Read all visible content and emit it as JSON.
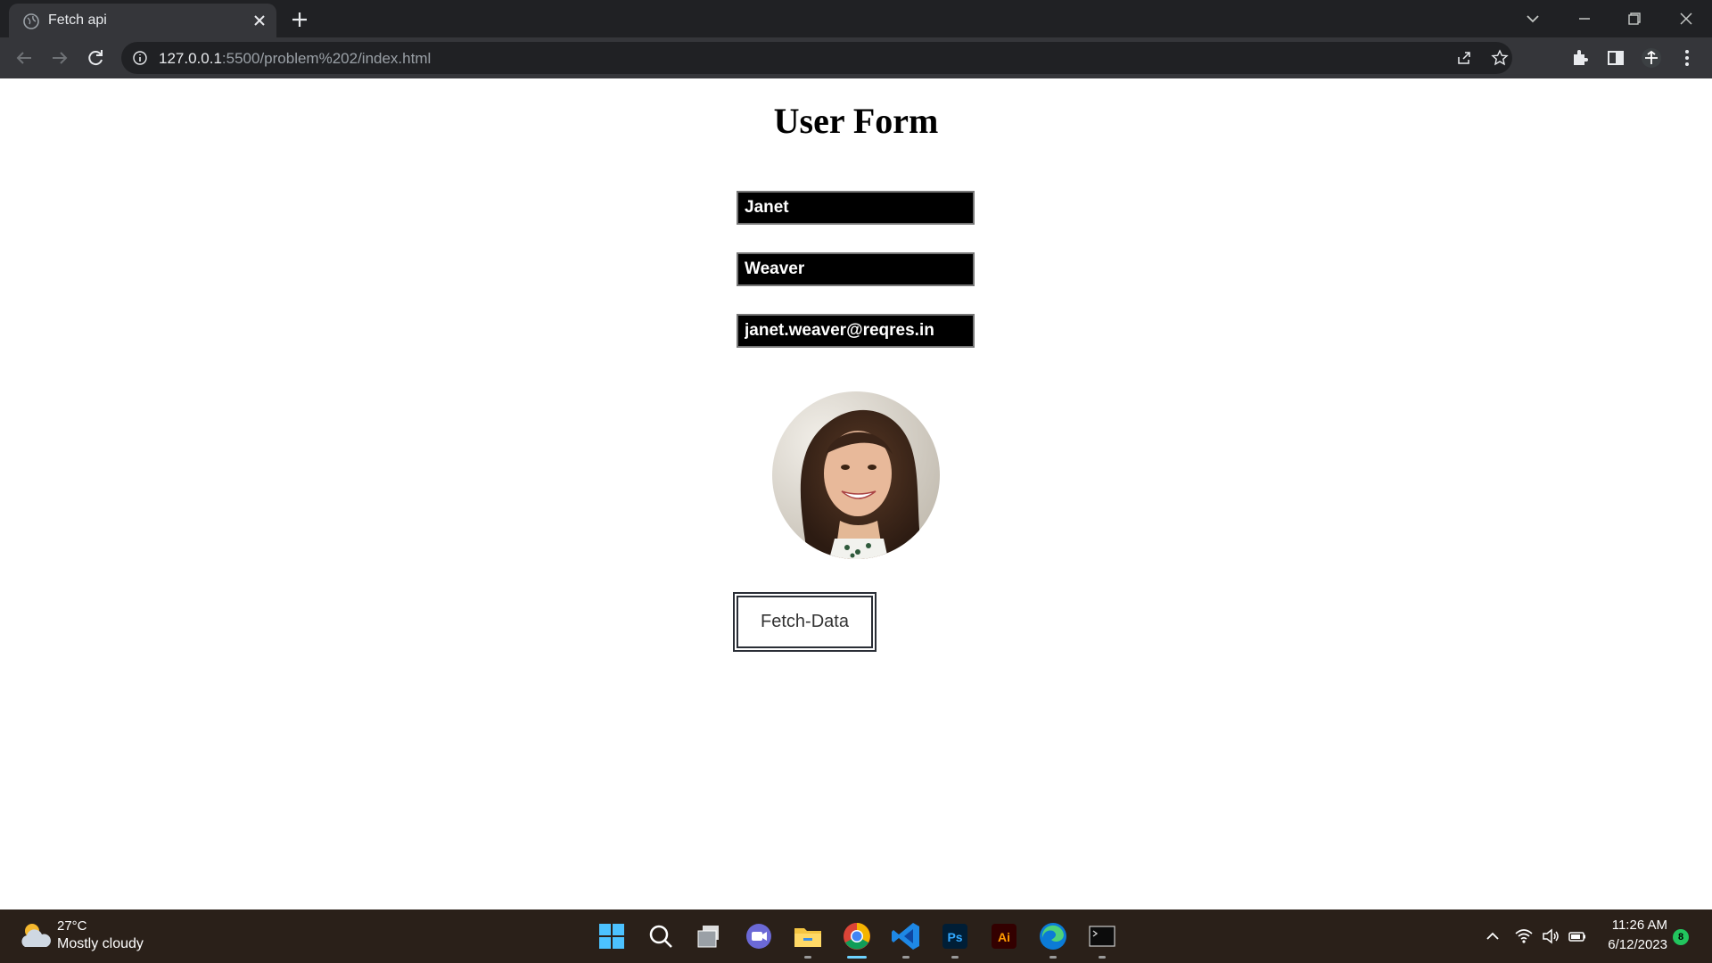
{
  "browser": {
    "tab_title": "Fetch api",
    "url_host": "127.0.0.1",
    "url_path": ":5500/problem%202/index.html"
  },
  "page": {
    "title": "User Form",
    "first_name": "Janet",
    "last_name": "Weaver",
    "email": "janet.weaver@reqres.in",
    "button_label": "Fetch-Data"
  },
  "taskbar": {
    "weather_temp": "27°C",
    "weather_desc": "Mostly cloudy",
    "time": "11:26 AM",
    "date": "6/12/2023",
    "notification_count": "8",
    "apps": [
      "start-icon",
      "search-icon",
      "task-view-icon",
      "teams-chat-icon",
      "file-explorer-icon",
      "chrome-icon",
      "vscode-icon",
      "photoshop-icon",
      "illustrator-icon",
      "edge-icon",
      "terminal-icon"
    ]
  },
  "colors": {
    "chrome_dark": "#202124",
    "tab_active": "#35363a",
    "field_bg": "#000000",
    "taskbar_bg": "#2a2019",
    "button_border": "#2a2e36"
  }
}
